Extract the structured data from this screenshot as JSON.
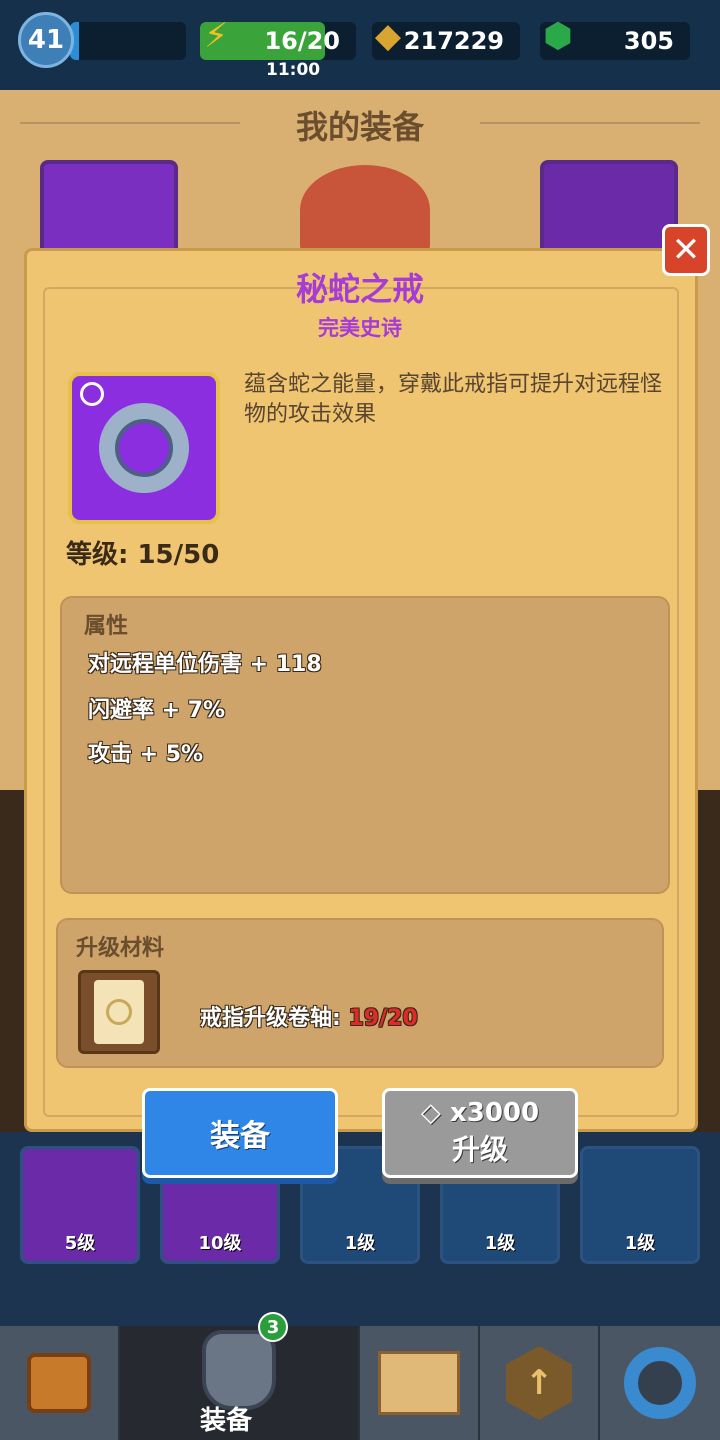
{
  "topbar": {
    "player_level": "41",
    "xp_progress": 0.08,
    "energy": "16/20",
    "energy_progress": 0.8,
    "energy_timer": "11:00",
    "gold": "217229",
    "gems": "305"
  },
  "background": {
    "title": "我的装备"
  },
  "item": {
    "name": "秘蛇之戒",
    "rarity": "完美史诗",
    "description": "蕴含蛇之能量，穿戴此戒指可提升对远程怪物的攻击效果",
    "level": "等级: 15/50"
  },
  "attributes": {
    "title": "属性",
    "lines": [
      "对远程单位伤害 + 118",
      "闪避率 + 7%",
      "攻击 + 5%"
    ]
  },
  "materials": {
    "title": "升级材料",
    "name": "戒指升级卷轴:",
    "count": "19/20"
  },
  "buttons": {
    "equip": "装备",
    "upgrade_cost": "x3000",
    "upgrade": "升级"
  },
  "inventory": [
    {
      "label": "5级",
      "color": "#6b2aa8"
    },
    {
      "label": "10级",
      "color": "#6b2aa8"
    },
    {
      "label": "1级",
      "color": "#1f4a78"
    },
    {
      "label": "1级",
      "color": "#1f4a78"
    },
    {
      "label": "1级",
      "color": "#1f4a78"
    }
  ],
  "bottomnav": {
    "equipment_label": "装备",
    "equipment_badge": "3"
  },
  "colors": {
    "epic_purple": "#a63bd6",
    "insufficient_red": "#e02a2a",
    "equip_blue": "#2f86e6",
    "upgrade_gray": "#9a9a9a"
  }
}
